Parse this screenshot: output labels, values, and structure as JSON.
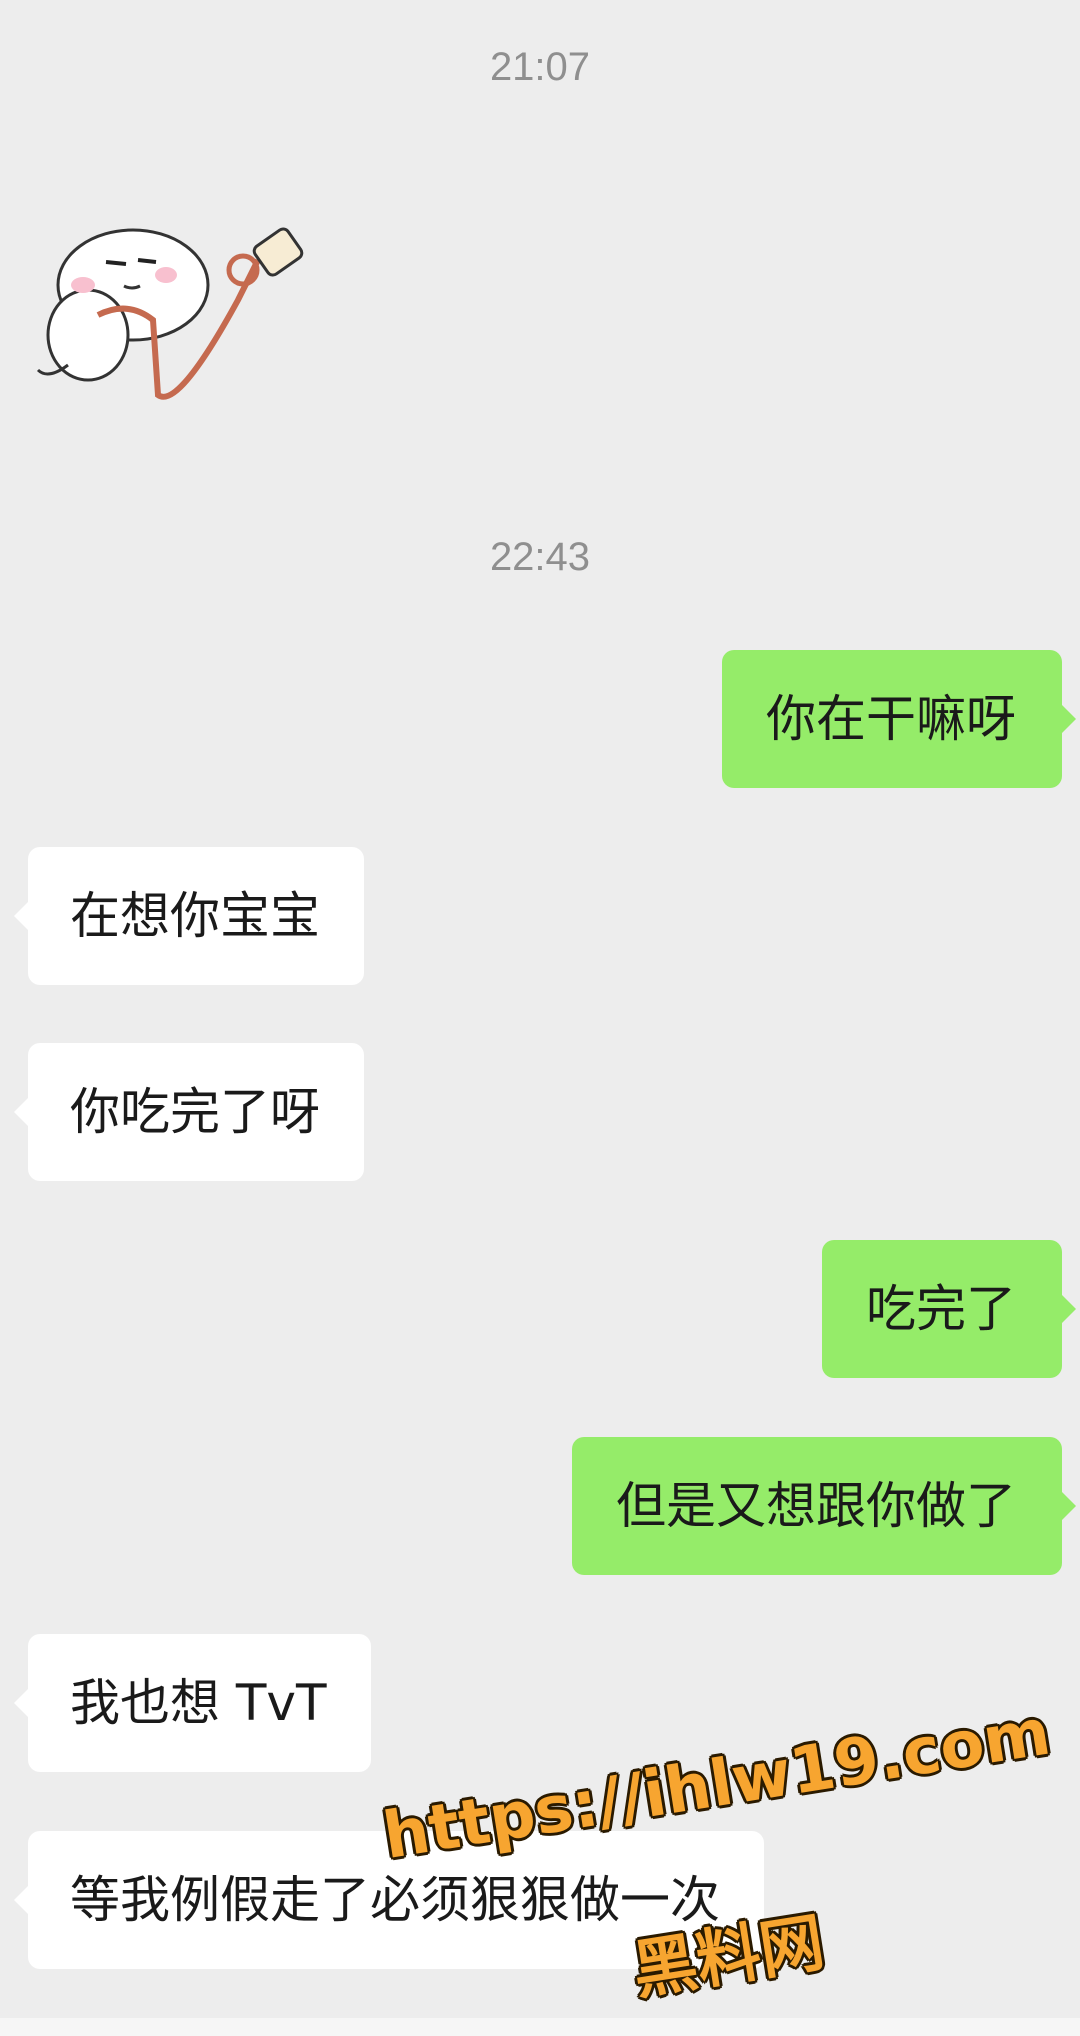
{
  "chat": {
    "timestamps": [
      "21:07",
      "22:43"
    ],
    "messages": [
      {
        "side": "out",
        "text": "你在干嘛呀"
      },
      {
        "side": "in",
        "text": "在想你宝宝"
      },
      {
        "side": "in",
        "text": "你吃完了呀"
      },
      {
        "side": "out",
        "text": "吃完了"
      },
      {
        "side": "out",
        "text": "但是又想跟你做了"
      },
      {
        "side": "in",
        "text": "我也想 TvT"
      },
      {
        "side": "in",
        "text": "等我例假走了必须狠狠做一次"
      }
    ],
    "sticker_icon": "puppy-with-leash-sticker"
  },
  "watermark": {
    "url": "https://ihlw19.com",
    "site_name": "黑料网"
  },
  "colors": {
    "background": "#ededed",
    "bubble_in": "#ffffff",
    "bubble_out": "#95ec69",
    "timestamp": "#8f8f8f",
    "watermark": "#f7a530"
  }
}
